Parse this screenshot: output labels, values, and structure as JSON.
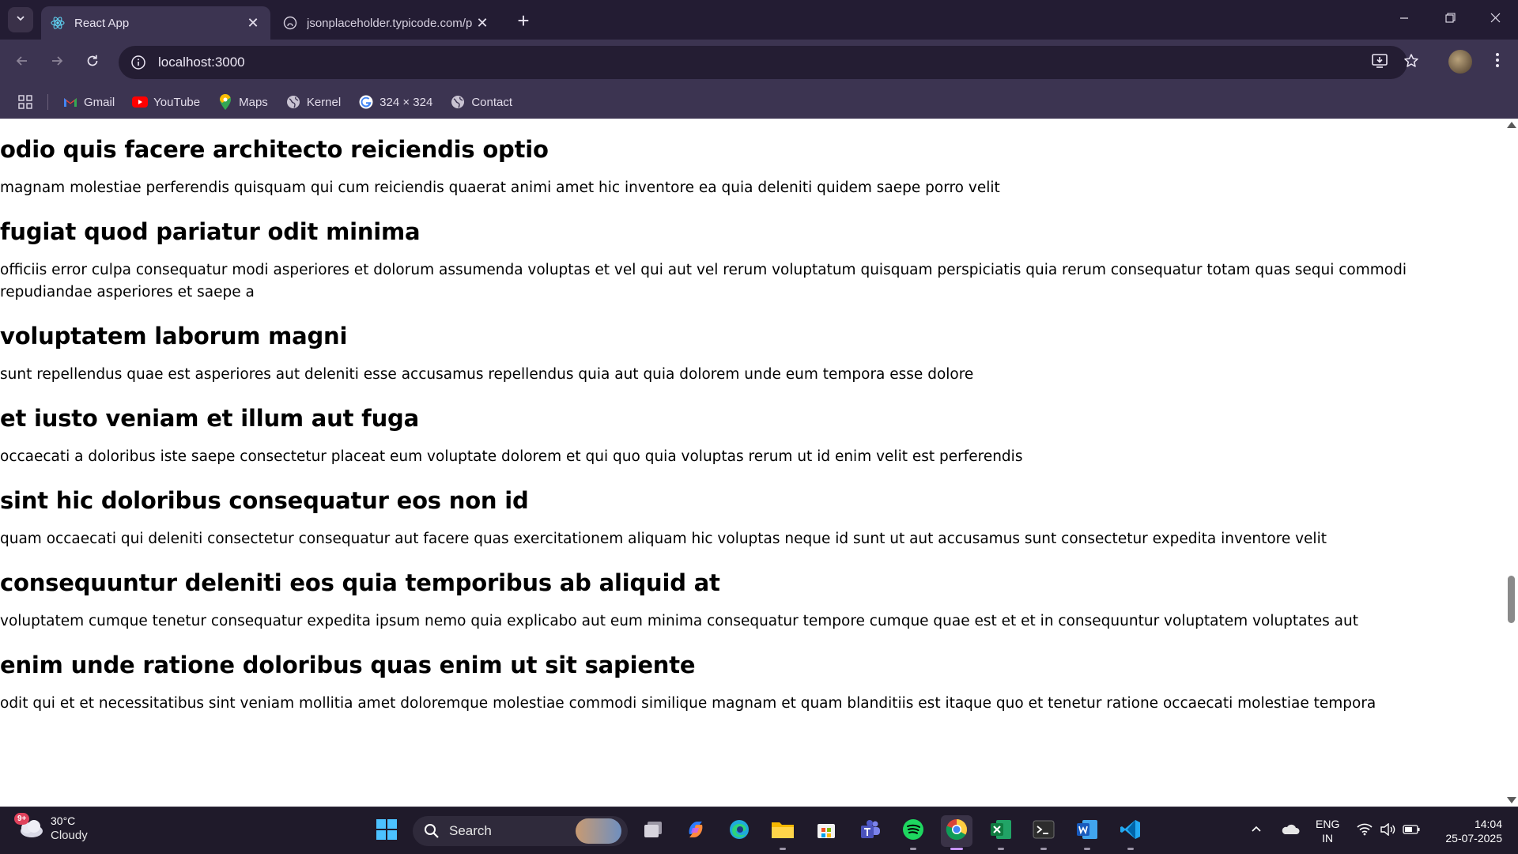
{
  "browser": {
    "tabs": [
      {
        "title": "React App",
        "active": true,
        "favicon": "react-icon"
      },
      {
        "title": "jsonplaceholder.typicode.com/p",
        "active": false,
        "favicon": "github-icon"
      }
    ],
    "address": "localhost:3000",
    "bookmarks": [
      {
        "label": "Gmail",
        "icon": "gmail-icon"
      },
      {
        "label": "YouTube",
        "icon": "youtube-icon"
      },
      {
        "label": "Maps",
        "icon": "maps-icon"
      },
      {
        "label": "Kernel",
        "icon": "globe-icon"
      },
      {
        "label": "324 × 324",
        "icon": "google-icon"
      },
      {
        "label": "Contact",
        "icon": "globe-icon"
      }
    ],
    "colors": {
      "frame": "#231c33",
      "toolbar": "#3c3451",
      "omnibox": "#241d33"
    }
  },
  "posts": [
    {
      "title": "odio quis facere architecto reiciendis optio",
      "body": "magnam molestiae perferendis quisquam qui cum reiciendis quaerat animi amet hic inventore ea quia deleniti quidem saepe porro velit"
    },
    {
      "title": "fugiat quod pariatur odit minima",
      "body": "officiis error culpa consequatur modi asperiores et dolorum assumenda voluptas et vel qui aut vel rerum voluptatum quisquam perspiciatis quia rerum consequatur totam quas sequi commodi repudiandae asperiores et saepe a"
    },
    {
      "title": "voluptatem laborum magni",
      "body": "sunt repellendus quae est asperiores aut deleniti esse accusamus repellendus quia aut quia dolorem unde eum tempora esse dolore"
    },
    {
      "title": "et iusto veniam et illum aut fuga",
      "body": "occaecati a doloribus iste saepe consectetur placeat eum voluptate dolorem et qui quo quia voluptas rerum ut id enim velit est perferendis"
    },
    {
      "title": "sint hic doloribus consequatur eos non id",
      "body": "quam occaecati qui deleniti consectetur consequatur aut facere quas exercitationem aliquam hic voluptas neque id sunt ut aut accusamus sunt consectetur expedita inventore velit"
    },
    {
      "title": "consequuntur deleniti eos quia temporibus ab aliquid at",
      "body": "voluptatem cumque tenetur consequatur expedita ipsum nemo quia explicabo aut eum minima consequatur tempore cumque quae est et et in consequuntur voluptatem voluptates aut"
    },
    {
      "title": "enim unde ratione doloribus quas enim ut sit sapiente",
      "body": "odit qui et et necessitatibus sint veniam mollitia amet doloremque molestiae commodi similique magnam et quam blanditiis est itaque quo et tenetur ratione occaecati molestiae tempora"
    }
  ],
  "taskbar": {
    "weather": {
      "temp": "30°C",
      "condition": "Cloudy",
      "badge": "9+"
    },
    "search_label": "Search",
    "apps": [
      "windows-start-icon",
      "task-view-icon",
      "copilot-icon",
      "edge-icon",
      "file-explorer-icon",
      "microsoft-store-icon",
      "teams-icon",
      "spotify-icon",
      "chrome-icon",
      "excel-icon",
      "terminal-icon",
      "word-icon",
      "vscode-icon"
    ],
    "language": {
      "line1": "ENG",
      "line2": "IN"
    },
    "clock": {
      "time": "14:04",
      "date": "25-07-2025"
    }
  }
}
